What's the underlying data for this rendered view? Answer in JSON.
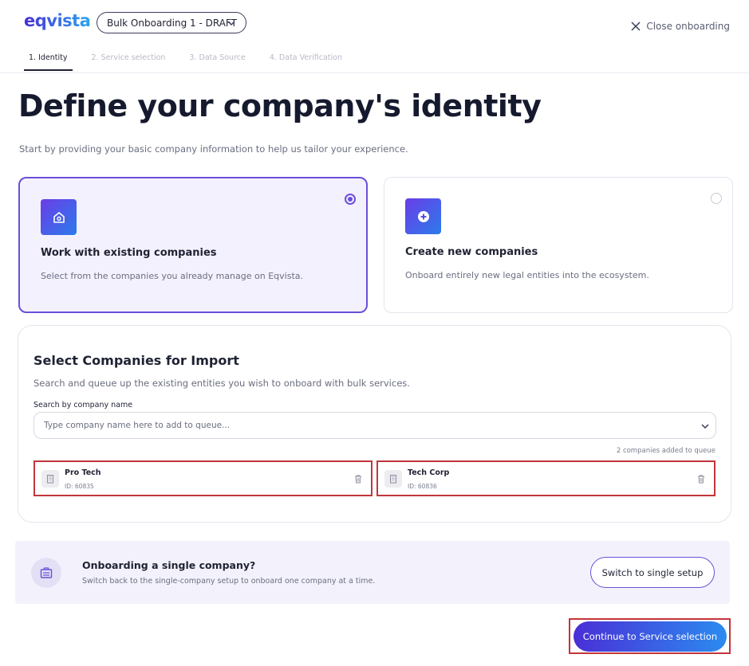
{
  "header": {
    "logo": "eqvista",
    "draft_select": "Bulk Onboarding 1 - DRAFT",
    "close_label": "Close onboarding",
    "tabs": [
      {
        "label": "1. Identity",
        "active": true
      },
      {
        "label": "2. Service selection",
        "active": false
      },
      {
        "label": "3. Data Source",
        "active": false
      },
      {
        "label": "4. Data Verification",
        "active": false
      }
    ]
  },
  "page": {
    "title": "Define your company's identity",
    "subtitle": "Start by providing your basic company information to help us tailor your experience."
  },
  "options": [
    {
      "title": "Work with existing companies",
      "desc": "Select from the companies you already manage on Eqvista.",
      "selected": true,
      "icon": "building-icon"
    },
    {
      "title": "Create new companies",
      "desc": "Onboard entirely new legal entities into the ecosystem.",
      "selected": false,
      "icon": "plus-circle-icon"
    }
  ],
  "import_panel": {
    "title": "Select Companies for Import",
    "desc": "Search and queue up the existing entities you wish to onboard with bulk services.",
    "search_label": "Search by company name",
    "search_placeholder": "Type company name here to add to queue...",
    "queue_count": "2 companies added to queue",
    "queued": [
      {
        "name": "Pro Tech",
        "id": "ID: 60835"
      },
      {
        "name": "Tech Corp",
        "id": "ID: 60836"
      }
    ]
  },
  "single_banner": {
    "title": "Onboarding a single company?",
    "desc": "Switch back to the single-company setup to onboard one company at a time.",
    "button": "Switch to single setup"
  },
  "footer": {
    "continue_button": "Continue to Service selection"
  },
  "colors": {
    "accent": "#6b4fd8",
    "highlight_border": "#c2353b",
    "gradient_start": "#4a2fd6",
    "gradient_end": "#2b8bf0"
  }
}
